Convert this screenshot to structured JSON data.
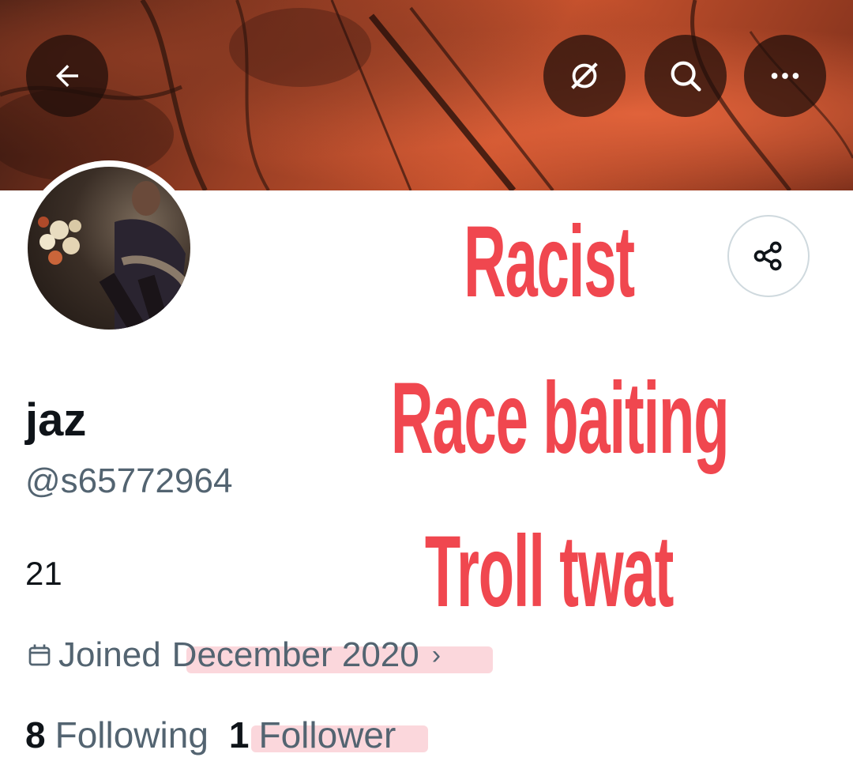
{
  "header": {
    "back_icon": "arrow-left-icon",
    "grok_icon": "slash-circle-icon",
    "search_icon": "search-icon",
    "more_icon": "more-dots-icon"
  },
  "profile": {
    "display_name": "jaz",
    "handle": "@s65772964",
    "bio": "21",
    "joined_label": "Joined",
    "joined_date": "December 2020",
    "joined_chevron": "›",
    "following_count": "8",
    "following_label": "Following",
    "followers_count": "1",
    "followers_label": "Follower"
  },
  "overlay_text": {
    "line1": "Racist",
    "line2": "Race baiting",
    "line3": "Troll twat"
  },
  "colors": {
    "overlay_red": "#f0474f",
    "secondary_text": "#536471",
    "primary_text": "#0f1419",
    "highlight_pink": "#f7b7c0"
  }
}
